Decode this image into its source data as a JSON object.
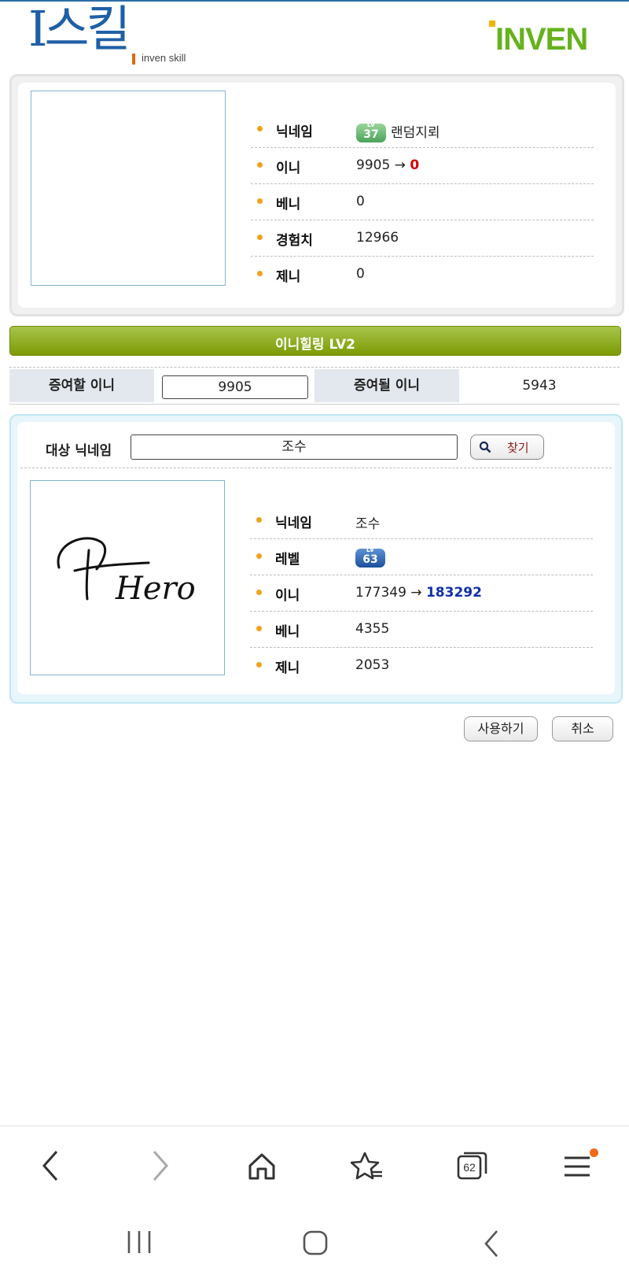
{
  "header": {
    "logo_ko": "I스킬",
    "logo_sub": "inven skill",
    "brand": "INVEN"
  },
  "profile": {
    "rows": [
      {
        "label": "닉네임",
        "badge": "37",
        "value": "랜덤지뢰"
      },
      {
        "label": "이니",
        "value": "9905 →",
        "value_highlight": "0"
      },
      {
        "label": "베니",
        "value": "0"
      },
      {
        "label": "경험치",
        "value": "12966"
      },
      {
        "label": "제니",
        "value": "0"
      }
    ],
    "badge_top": "LV"
  },
  "skill_title": "이니힐링 LV2",
  "gift": {
    "give_label": "증여할 이니",
    "give_value": "9905",
    "receive_label": "증여될 이니",
    "receive_value": "5943"
  },
  "target": {
    "search_label": "대상 닉네임",
    "search_value": "조수",
    "find_label": "찾기",
    "signature_text": "Hero",
    "rows": [
      {
        "label": "닉네임",
        "value": "조수"
      },
      {
        "label": "레벨",
        "badge": "63"
      },
      {
        "label": "이니",
        "value": "177349 →",
        "value_highlight": "183292"
      },
      {
        "label": "베니",
        "value": "4355"
      },
      {
        "label": "제니",
        "value": "2053"
      }
    ]
  },
  "actions": {
    "use_label": "사용하기",
    "cancel_label": "취소"
  },
  "browser_nav": {
    "tabs_count": "62"
  },
  "colors": {
    "accent_green": "#7d9a06",
    "accent_orange": "#f0a21c",
    "red": "#d10000",
    "blue": "#1030a8",
    "brand_green": "#66b21e"
  }
}
